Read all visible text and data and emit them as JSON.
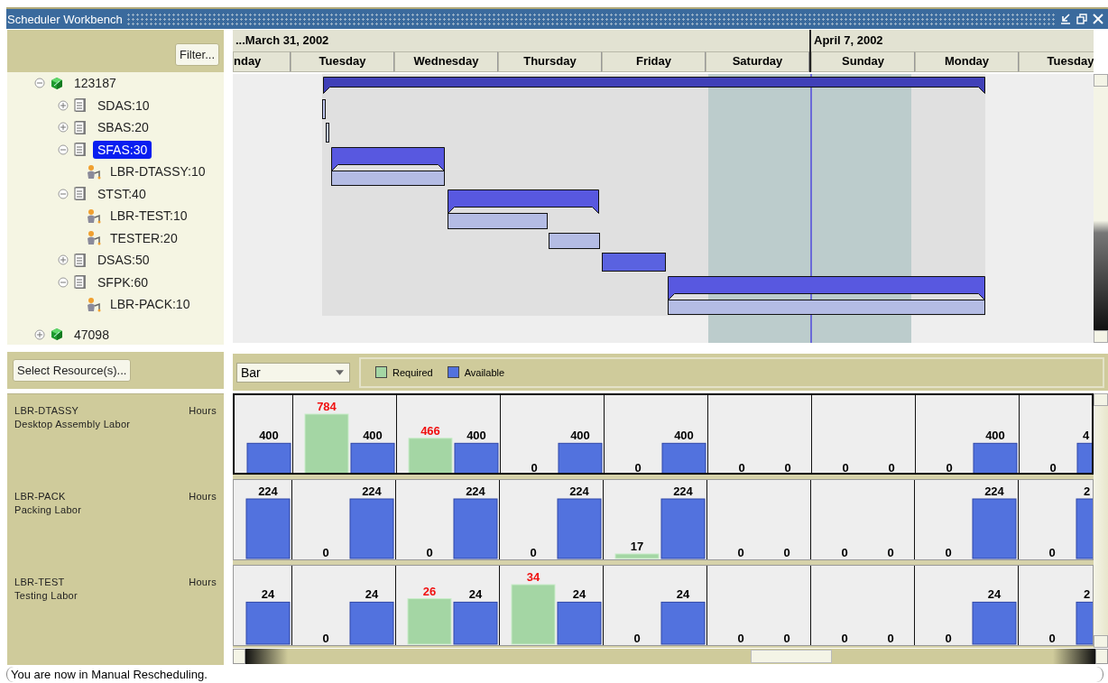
{
  "window": {
    "title": "Scheduler Workbench"
  },
  "filter_button": "Filter...",
  "tree": [
    {
      "label": "123187",
      "kind": "order",
      "expanded": true,
      "selected": false,
      "children": [
        {
          "label": "SDAS:10",
          "kind": "operation",
          "expanded": false,
          "selected": false
        },
        {
          "label": "SBAS:20",
          "kind": "operation",
          "expanded": false,
          "selected": false
        },
        {
          "label": "SFAS:30",
          "kind": "operation",
          "expanded": true,
          "selected": true,
          "children": [
            {
              "label": "LBR-DTASSY:10",
              "kind": "resource",
              "selected": false
            }
          ]
        },
        {
          "label": "STST:40",
          "kind": "operation",
          "expanded": true,
          "selected": false,
          "children": [
            {
              "label": "LBR-TEST:10",
              "kind": "resource",
              "selected": false
            },
            {
              "label": "TESTER:20",
              "kind": "resource",
              "selected": false
            }
          ]
        },
        {
          "label": "DSAS:50",
          "kind": "operation",
          "expanded": false,
          "selected": false
        },
        {
          "label": "SFPK:60",
          "kind": "operation",
          "expanded": true,
          "selected": false,
          "children": [
            {
              "label": "LBR-PACK:10",
              "kind": "resource",
              "selected": false
            }
          ]
        }
      ]
    },
    {
      "label": "47098",
      "kind": "order",
      "expanded": false,
      "selected": false
    }
  ],
  "timeline": {
    "date_groups": [
      {
        "label": "...March 31, 2002",
        "days": [
          "nday",
          "Tuesday",
          "Wednesday",
          "Thursday",
          "Friday",
          "Saturday"
        ]
      },
      {
        "label": "April 7, 2002",
        "days": [
          "Sunday",
          "Monday",
          "Tuesday"
        ]
      }
    ]
  },
  "select_button": "Select Resource(s)...",
  "view_select": {
    "value": "Bar"
  },
  "legend": [
    {
      "label": "Required",
      "color": "#a4d6a4"
    },
    {
      "label": "Available",
      "color": "#5272de"
    }
  ],
  "resources": [
    {
      "code": "LBR-DTASSY",
      "description": "Desktop Assembly Labor",
      "unit": "Hours",
      "selected": true,
      "days": [
        {
          "available": {
            "label": "400"
          }
        },
        {
          "required": {
            "label": "784",
            "over": true
          },
          "available": {
            "label": "400"
          }
        },
        {
          "required": {
            "label": "466",
            "over": true
          },
          "available": {
            "label": "400"
          }
        },
        {
          "required": {
            "label": "0",
            "over": false
          },
          "available": {
            "label": "400"
          }
        },
        {
          "required": {
            "label": "0",
            "over": false
          },
          "available": {
            "label": "400"
          }
        },
        {
          "required": {
            "label": "0",
            "over": false
          },
          "available": {
            "label": "0"
          }
        },
        {
          "required": {
            "label": "0",
            "over": false
          },
          "available": {
            "label": "0"
          }
        },
        {
          "required": {
            "label": "0",
            "over": false
          },
          "available": {
            "label": "400"
          }
        },
        {
          "required": {
            "label": "0",
            "over": false
          },
          "available": {
            "label": "4"
          }
        }
      ]
    },
    {
      "code": "LBR-PACK",
      "description": "Packing Labor",
      "unit": "Hours",
      "selected": false,
      "days": [
        {
          "available": {
            "label": "224"
          }
        },
        {
          "required": {
            "label": "0",
            "over": false
          },
          "available": {
            "label": "224"
          }
        },
        {
          "required": {
            "label": "0",
            "over": false
          },
          "available": {
            "label": "224"
          }
        },
        {
          "required": {
            "label": "0",
            "over": false
          },
          "available": {
            "label": "224"
          }
        },
        {
          "required": {
            "label": "17",
            "over": false
          },
          "available": {
            "label": "224"
          }
        },
        {
          "required": {
            "label": "0",
            "over": false
          },
          "available": {
            "label": "0"
          }
        },
        {
          "required": {
            "label": "0",
            "over": false
          },
          "available": {
            "label": "0"
          }
        },
        {
          "required": {
            "label": "0",
            "over": false
          },
          "available": {
            "label": "224"
          }
        },
        {
          "required": {
            "label": "0",
            "over": false
          },
          "available": {
            "label": "2"
          }
        }
      ]
    },
    {
      "code": "LBR-TEST",
      "description": "Testing Labor",
      "unit": "Hours",
      "selected": false,
      "days": [
        {
          "available": {
            "label": "24"
          }
        },
        {
          "required": {
            "label": "0",
            "over": false
          },
          "available": {
            "label": "24"
          }
        },
        {
          "required": {
            "label": "26",
            "over": true
          },
          "available": {
            "label": "24"
          }
        },
        {
          "required": {
            "label": "34",
            "over": true
          },
          "available": {
            "label": "24"
          }
        },
        {
          "required": {
            "label": "0",
            "over": false
          },
          "available": {
            "label": "24"
          }
        },
        {
          "required": {
            "label": "0",
            "over": false
          },
          "available": {
            "label": "0"
          }
        },
        {
          "required": {
            "label": "0",
            "over": false
          },
          "available": {
            "label": "0"
          }
        },
        {
          "required": {
            "label": "0",
            "over": false
          },
          "available": {
            "label": "24"
          }
        },
        {
          "required": {
            "label": "0",
            "over": false
          },
          "available": {
            "label": "2"
          }
        }
      ]
    }
  ],
  "status_bar": "You are now in Manual Rescheduling."
}
